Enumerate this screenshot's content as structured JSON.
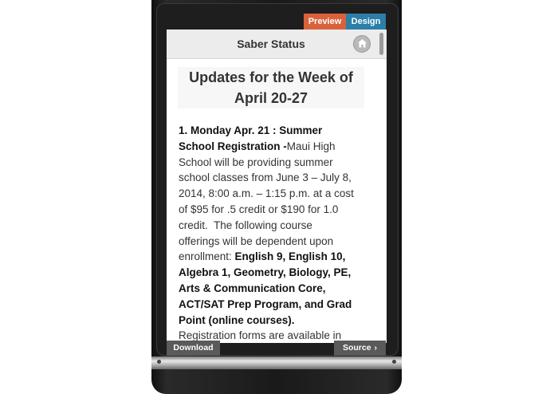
{
  "tabs": {
    "preview": "Preview",
    "design": "Design"
  },
  "header": {
    "title": "Saber Status",
    "home_icon": "home-icon"
  },
  "content": {
    "headline_line1": "Updates for the Week of",
    "headline_line2": "April 20-27",
    "paragraph": [
      {
        "bold": "1. Monday Apr. 21 : Summer",
        "text": ""
      },
      {
        "bold": "School Registration -",
        "text": "Maui High"
      },
      {
        "bold": "",
        "text": "School will be providing summer"
      },
      {
        "bold": "",
        "text": "school classes from June 3 – July 8,"
      },
      {
        "bold": "",
        "text": "2014, 8:00 a.m. – 1:15 p.m. at a cost"
      },
      {
        "bold": "",
        "text": "of $95 for .5 credit or $190 for 1.0"
      },
      {
        "bold": "",
        "text": "credit.  The following course"
      },
      {
        "bold": "",
        "text": "offerings will be dependent upon"
      },
      {
        "bold_after": "English 9, English 10,",
        "text": "enrollment: "
      },
      {
        "bold": "Algebra 1, Geometry, Biology, PE,",
        "text": ""
      },
      {
        "bold": "Arts & Communication Core,",
        "text": ""
      },
      {
        "bold": "ACT/SAT Prep Program, and Grad",
        "text": ""
      },
      {
        "bold": "Point (online courses).",
        "text": ""
      },
      {
        "bold": "",
        "text": "Registration forms are available in"
      }
    ]
  },
  "footer": {
    "download": "Download",
    "source": "Source",
    "source_icon": "chevron-right-icon"
  },
  "colors": {
    "preview_tab": "#d9623a",
    "design_tab": "#2b7fa8"
  }
}
